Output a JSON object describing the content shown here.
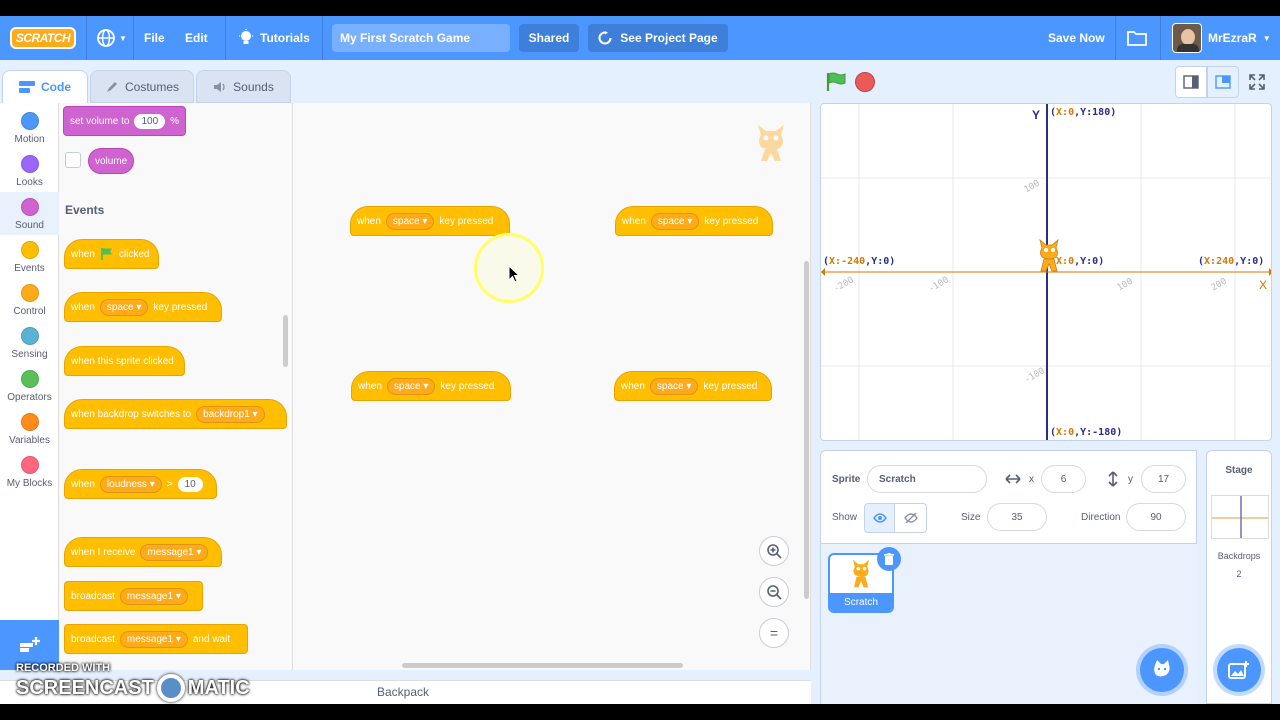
{
  "menubar": {
    "logo": "SCRATCH",
    "file": "File",
    "edit": "Edit",
    "tutorials": "Tutorials",
    "project_title": "My First Scratch Game",
    "shared": "Shared",
    "see_project": "See Project Page",
    "save_now": "Save Now",
    "username": "MrEzraR"
  },
  "tabs": {
    "code": "Code",
    "costumes": "Costumes",
    "sounds": "Sounds"
  },
  "categories": [
    {
      "label": "Motion",
      "color": "#4c97ff"
    },
    {
      "label": "Looks",
      "color": "#9966ff"
    },
    {
      "label": "Sound",
      "color": "#cf63cf"
    },
    {
      "label": "Events",
      "color": "#ffbf00"
    },
    {
      "label": "Control",
      "color": "#ffab19"
    },
    {
      "label": "Sensing",
      "color": "#5cb1d6"
    },
    {
      "label": "Operators",
      "color": "#59c059"
    },
    {
      "label": "Variables",
      "color": "#ff8c1a"
    },
    {
      "label": "My Blocks",
      "color": "#ff6680"
    }
  ],
  "palette": {
    "set_volume": "set volume to",
    "set_volume_value": "100",
    "set_volume_unit": "%",
    "volume": "volume",
    "events_heading": "Events",
    "when": "when",
    "clicked": "clicked",
    "space": "space",
    "key_pressed": "key pressed",
    "when_sprite_clicked": "when this sprite clicked",
    "when_backdrop": "when backdrop switches to",
    "backdrop1": "backdrop1",
    "loudness": "loudness",
    "gt": ">",
    "loudness_value": "10",
    "when_receive": "when I receive",
    "message1": "message1",
    "broadcast": "broadcast",
    "and_wait": "and wait"
  },
  "workspace": {
    "when": "when",
    "space": "space",
    "key_pressed": "key pressed",
    "zoom_in": "+",
    "zoom_out": "−",
    "reset": "="
  },
  "backpack": "Backpack",
  "stage": {
    "y_label": "Y",
    "x_label": "X",
    "top": {
      "x": "X:0",
      "y": "Y:180"
    },
    "bottom": {
      "x": "X:0",
      "y": "Y:-180"
    },
    "left": {
      "x": "X:-240",
      "y": "Y:0"
    },
    "right": {
      "x": "X:240",
      "y": "Y:0"
    },
    "center": {
      "x": "X:0",
      "y": "Y:0"
    },
    "ticks": [
      "100",
      "-100",
      "-200",
      "100",
      "200",
      "-100"
    ]
  },
  "sprite_info": {
    "sprite_label": "Sprite",
    "sprite_name": "Scratch",
    "x_label": "x",
    "x_value": "6",
    "y_label": "y",
    "y_value": "17",
    "show_label": "Show",
    "size_label": "Size",
    "size_value": "35",
    "direction_label": "Direction",
    "direction_value": "90"
  },
  "sprite_thumb": "Scratch",
  "stage_panel": {
    "title": "Stage",
    "backdrops_label": "Backdrops",
    "backdrops_count": "2"
  },
  "watermark": {
    "line1": "RECORDED WITH",
    "line2": "SCREENCAST",
    "line3": "MATIC"
  }
}
